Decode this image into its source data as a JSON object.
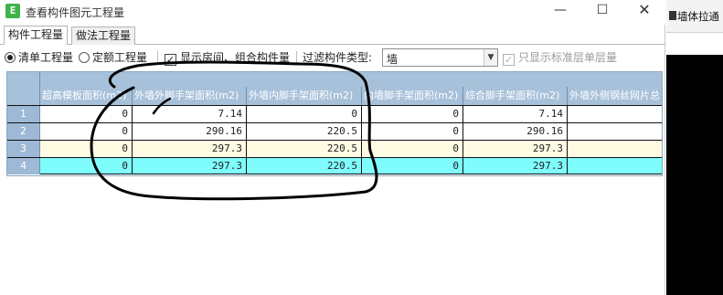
{
  "window": {
    "title": "查看构件图元工程量",
    "icon_glyph": "E",
    "minimize_glyph": "—",
    "maximize_glyph": "☐",
    "close_glyph": "✕"
  },
  "tabs": [
    {
      "label": "构件工程量",
      "active": true
    },
    {
      "label": "做法工程量",
      "active": false
    }
  ],
  "options": {
    "radio_qingdan": "清单工程量",
    "radio_ding_e": "定额工程量",
    "show_room_label": "显示房间、组合构件量",
    "filter_label": "过滤构件类型:",
    "filter_value": "墙",
    "standard_floor_label": "只显示标准层单层量"
  },
  "grid": {
    "columns": [
      "超高模板面积(m2)",
      "外墙外脚手架面积(m2)",
      "外墙内脚手架面积(m2)",
      "内墙脚手架面积(m2)",
      "综合脚手架面积(m2)",
      "外墙外侧钢丝网片总"
    ],
    "rows": [
      {
        "num": "1",
        "cells": [
          "0",
          "7.14",
          "0",
          "0",
          "7.14",
          ""
        ]
      },
      {
        "num": "2",
        "cells": [
          "0",
          "290.16",
          "220.5",
          "0",
          "290.16",
          ""
        ]
      },
      {
        "num": "3",
        "cells": [
          "0",
          "297.3",
          "220.5",
          "0",
          "297.3",
          ""
        ]
      },
      {
        "num": "4",
        "cells": [
          "0",
          "297.3",
          "220.5",
          "0",
          "297.3",
          ""
        ]
      }
    ]
  },
  "background_window": {
    "label": "墙体拉通"
  },
  "colors": {
    "header_bg": "#a8c1da",
    "row_highlight_cream": "#fffbe3",
    "row_highlight_cyan": "#7ffdfd",
    "scribble": "#000000"
  }
}
